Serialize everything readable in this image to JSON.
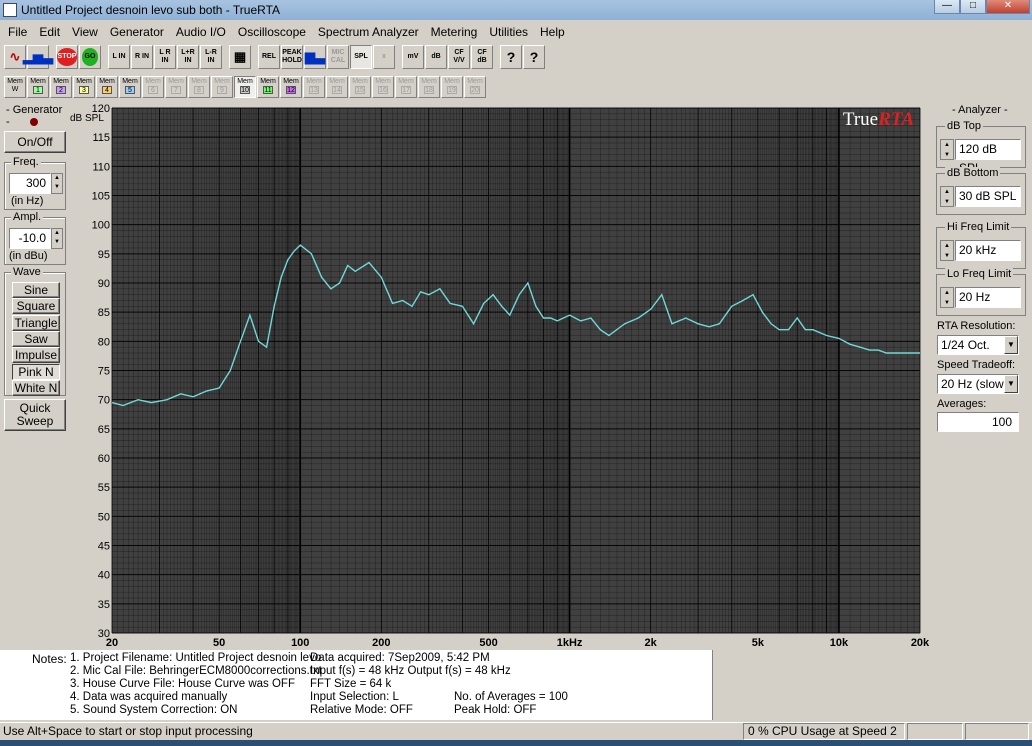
{
  "window": {
    "title": "Untitled Project desnoin levo sub both - TrueRTA"
  },
  "menu": [
    "File",
    "Edit",
    "View",
    "Generator",
    "Audio I/O",
    "Oscilloscope",
    "Spectrum Analyzer",
    "Metering",
    "Utilities",
    "Help"
  ],
  "toolbar": [
    "sine-icon",
    "spectrum-icon",
    "STOP",
    "GO",
    "L IN",
    "R IN",
    "L R IN",
    "L+R IN",
    "L-R IN",
    "grid-icon",
    "REL",
    "PEAK HOLD",
    "bars-icon",
    "MIC CAL",
    "SPL",
    "x",
    "mV",
    "dB",
    "CF V/V",
    "CF dB",
    "?",
    "?"
  ],
  "memories": {
    "labels": [
      "W",
      "1",
      "2",
      "3",
      "4",
      "5",
      "6",
      "7",
      "8",
      "9",
      "10",
      "11",
      "12",
      "13",
      "14",
      "15",
      "16",
      "17",
      "18",
      "19",
      "20"
    ],
    "prefix": "Mem",
    "active": "10"
  },
  "generator": {
    "title": "- Generator -",
    "onoff": "On/Off",
    "freq_label": "Freq.",
    "freq_value": "300",
    "freq_unit": "(in Hz)",
    "ampl_label": "Ampl.",
    "ampl_value": "-10.0",
    "ampl_unit": "(in dBu)",
    "wave_label": "Wave",
    "waves": [
      "Sine",
      "Square",
      "Triangle",
      "Saw",
      "Impulse",
      "Pink N",
      "White N"
    ],
    "selected_wave": "Pink N",
    "quick_sweep": "Quick Sweep"
  },
  "analyzer": {
    "title": "- Analyzer -",
    "db_top_label": "dB Top",
    "db_top": "120 dB SPL",
    "db_bottom_label": "dB Bottom",
    "db_bottom": "30 dB SPL",
    "hi_label": "Hi Freq Limit",
    "hi": "20 kHz",
    "lo_label": "Lo Freq Limit",
    "lo": "20 Hz",
    "res_label": "RTA Resolution:",
    "res": "1/24 Oct.",
    "speed_label": "Speed Tradeoff:",
    "speed": "20 Hz (slow)",
    "avg_label": "Averages:",
    "avg": "100"
  },
  "colors": {
    "plot_bg": "#404040",
    "grid": "#000000",
    "trace": "#70d8d8",
    "logo_red": "#e02020"
  },
  "chart_data": {
    "type": "line",
    "ylabel": "dB SPL",
    "logo": "TrueRTA",
    "x_scale": "log",
    "xlim": [
      20,
      20000
    ],
    "ylim": [
      30,
      120
    ],
    "y_ticks": [
      30,
      35,
      40,
      45,
      50,
      55,
      60,
      65,
      70,
      75,
      80,
      85,
      90,
      95,
      100,
      105,
      110,
      115,
      120
    ],
    "x_ticks": [
      {
        "v": 20,
        "l": "20"
      },
      {
        "v": 50,
        "l": "50"
      },
      {
        "v": 100,
        "l": "100"
      },
      {
        "v": 200,
        "l": "200"
      },
      {
        "v": 500,
        "l": "500"
      },
      {
        "v": 1000,
        "l": "1kHz"
      },
      {
        "v": 2000,
        "l": "2k"
      },
      {
        "v": 5000,
        "l": "5k"
      },
      {
        "v": 10000,
        "l": "10k"
      },
      {
        "v": 20000,
        "l": "20k"
      }
    ],
    "grid": true,
    "series": [
      {
        "x": [
          20,
          22,
          25,
          28,
          32,
          36,
          40,
          45,
          50,
          55,
          60,
          65,
          70,
          75,
          80,
          85,
          90,
          95,
          100,
          110,
          120,
          130,
          140,
          150,
          160,
          180,
          200,
          220,
          240,
          260,
          280,
          300,
          330,
          360,
          400,
          440,
          480,
          520,
          560,
          600,
          650,
          700,
          750,
          800,
          850,
          900,
          1000,
          1100,
          1200,
          1300,
          1400,
          1600,
          1800,
          2000,
          2200,
          2400,
          2700,
          3000,
          3300,
          3600,
          4000,
          4400,
          4800,
          5200,
          5600,
          6000,
          6500,
          7000,
          7500,
          8000,
          9000,
          10000,
          11000,
          12000,
          13000,
          14000,
          15000,
          16000,
          17000,
          18000,
          19000,
          20000
        ],
        "y": [
          69.5,
          69,
          70,
          69.5,
          70,
          71,
          70.5,
          71.5,
          72,
          75,
          80,
          84.5,
          80,
          79,
          86,
          91,
          94,
          95.5,
          96.5,
          95,
          91,
          89,
          90,
          93,
          92,
          93.5,
          91,
          86.5,
          87,
          86,
          88.5,
          88,
          89,
          86.5,
          86,
          83,
          86.5,
          88,
          86,
          84.5,
          88,
          90,
          86,
          84,
          84,
          83.5,
          84.5,
          83.5,
          84,
          82,
          81,
          83,
          84,
          85.5,
          88,
          83,
          84,
          83,
          82.5,
          83,
          86,
          87,
          88,
          85,
          83,
          82,
          82,
          84,
          82,
          82,
          81,
          80.5,
          79.5,
          79,
          78.5,
          78.5,
          78,
          78,
          78,
          78,
          78,
          78
        ]
      }
    ]
  },
  "notes": {
    "label": "Notes:",
    "rows": [
      [
        "1. Project Filename: Untitled Project desnoin levo",
        "Data acquired: 7Sep2009, 5:42 PM",
        ""
      ],
      [
        "2. Mic Cal File: BehringerECM8000corrections.txt",
        "Input f(s) = 48 kHz   Output f(s) = 48 kHz",
        ""
      ],
      [
        "3. House Curve File: House Curve was OFF",
        "FFT Size = 64 k",
        ""
      ],
      [
        "4. Data was acquired manually",
        "Input Selection: L",
        "No. of Averages = 100"
      ],
      [
        "5. Sound System Correction: ON",
        "Relative Mode:  OFF",
        "Peak Hold: OFF"
      ]
    ]
  },
  "status": {
    "hint": "Use Alt+Space to start or stop input processing",
    "cpu": "0 % CPU Usage at Speed 2"
  }
}
